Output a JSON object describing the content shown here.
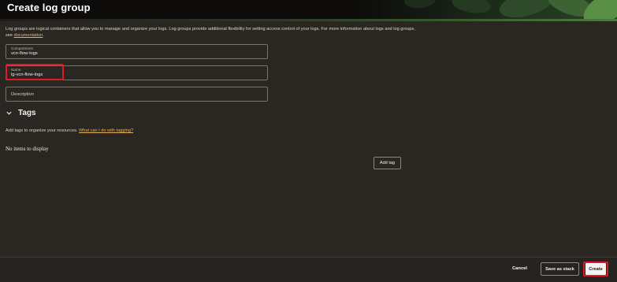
{
  "header": {
    "title": "Create log group"
  },
  "intro": {
    "text": "Log groups are logical containers that allow you to manage and organize your logs. Log groups provide additional flexibility for setting access control of your logs. For more information about logs and log groups, see ",
    "link_label": "documentation",
    "suffix": "."
  },
  "form": {
    "compartment": {
      "label": "Compartment",
      "value": "vcn-flow-logs"
    },
    "name": {
      "label": "Name",
      "value": "lg-vcn-flow-logs"
    },
    "description": {
      "placeholder": "Description"
    }
  },
  "tags": {
    "title": "Tags",
    "help_text": "Add tags to organize your resources.",
    "help_link": "What can I do with tagging?",
    "empty_text": "No items to display",
    "add_button": "Add tag"
  },
  "footer": {
    "cancel": "Cancel",
    "save_as_stack": "Save as stack",
    "create": "Create"
  },
  "colors": {
    "highlight": "#e0192a",
    "link": "#e6b35a",
    "background": "#2a2723"
  }
}
